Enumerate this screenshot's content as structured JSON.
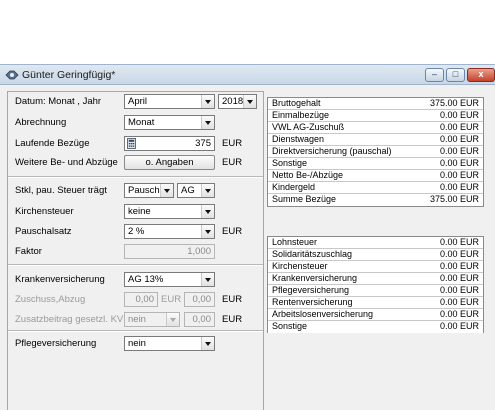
{
  "window": {
    "title": "Günter Geringfügig*",
    "min_glyph": "–",
    "max_glyph": "□",
    "close_glyph": "x"
  },
  "form": {
    "datum_label": "Datum: Monat , Jahr",
    "month_value": "April",
    "year_value": "2018",
    "abrechnung_label": "Abrechnung",
    "abrechnung_value": "Monat",
    "laufende_label": "Laufende Bezüge",
    "laufende_value": "375",
    "laufende_unit": "EUR",
    "weitere_label": "Weitere Be- und Abzüge",
    "weitere_button": "o. Angaben",
    "weitere_unit": "EUR",
    "stkl_label": "Stkl, pau. Steuer trägt",
    "stkl_value": "Pausch",
    "stkl_traeger": "AG",
    "kirchensteuer_label": "Kirchensteuer",
    "kirchensteuer_value": "keine",
    "pauschalsatz_label": "Pauschalsatz",
    "pauschalsatz_value": "2 %",
    "pauschalsatz_unit": "EUR",
    "faktor_label": "Faktor",
    "faktor_value": "1,000",
    "kv_label": "Krankenversicherung",
    "kv_value": "AG 13%",
    "zuschuss_label": "Zuschuss,Abzug",
    "zuschuss_value1": "0,00",
    "zuschuss_unit1": "EUR",
    "zuschuss_value2": "0,00",
    "zuschuss_unit2": "EUR",
    "zusatz_label": "Zusatzbeitrag gesetzl. KV",
    "zusatz_value": "nein",
    "zusatz_amount": "0,00",
    "zusatz_unit": "EUR",
    "pv_label": "Pflegeversicherung",
    "pv_value": "nein"
  },
  "summary_top": [
    {
      "label": "Bruttogehalt",
      "value": "375.00 EUR"
    },
    {
      "label": "Einmalbezüge",
      "value": "0.00 EUR"
    },
    {
      "label": "VWL AG-Zuschuß",
      "value": "0.00 EUR"
    },
    {
      "label": "Dienstwagen",
      "value": "0.00 EUR"
    },
    {
      "label": "Direktversicherung (pauschal)",
      "value": "0.00 EUR"
    },
    {
      "label": "Sonstige",
      "value": "0.00 EUR"
    },
    {
      "label": "Netto Be-/Abzüge",
      "value": "0.00 EUR"
    },
    {
      "label": "Kindergeld",
      "value": "0.00 EUR"
    },
    {
      "label": "Summe Bezüge",
      "value": "375.00 EUR"
    }
  ],
  "summary_bottom": [
    {
      "label": "Lohnsteuer",
      "value": "0.00 EUR"
    },
    {
      "label": "Solidaritätszuschlag",
      "value": "0.00 EUR"
    },
    {
      "label": "Kirchensteuer",
      "value": "0.00 EUR"
    },
    {
      "label": "Krankenversicherung",
      "value": "0.00 EUR"
    },
    {
      "label": "Pflegeversicherung",
      "value": "0.00 EUR"
    },
    {
      "label": "Rentenversicherung",
      "value": "0.00 EUR"
    },
    {
      "label": "Arbeitslosenversicherung",
      "value": "0.00 EUR"
    },
    {
      "label": "Sonstige",
      "value": "0.00 EUR"
    }
  ],
  "colors": {
    "titlebar": "#c9d7e6",
    "client": "#f0f0f0",
    "close_button": "#c4432c"
  }
}
